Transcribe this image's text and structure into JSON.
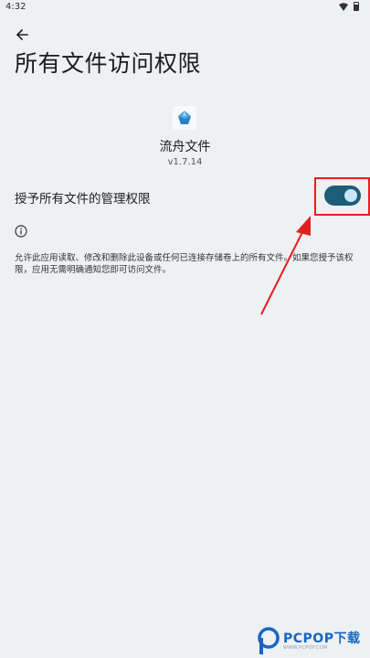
{
  "status_bar": {
    "time": "4:32",
    "icons": [
      "wifi-icon",
      "battery-icon"
    ]
  },
  "header": {
    "back_icon": "arrow-back-icon",
    "title": "所有文件访问权限"
  },
  "app": {
    "icon": "app-icon",
    "name": "流舟文件",
    "version": "v1.7.14"
  },
  "permission": {
    "label": "授予所有文件的管理权限",
    "enabled": true,
    "toggle_color": "#1d5d78",
    "thumb_color": "#c7e7fb"
  },
  "info": {
    "icon": "info-icon",
    "description": "允许此应用读取、修改和删除此设备或任何已连接存储卷上的所有文件。如果您授予该权限，应用无需明确通知您即可访问文件。"
  },
  "annotation": {
    "highlight_color": "#e02020"
  },
  "watermark": {
    "brand": "PCPOP下载",
    "sub": "WWW.PCPOP.COM"
  }
}
